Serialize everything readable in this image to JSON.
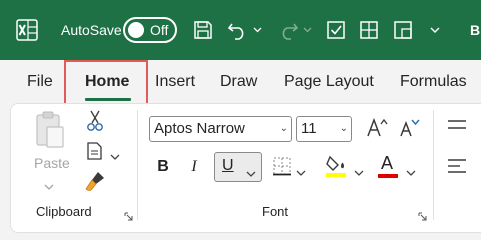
{
  "titlebar": {
    "autosave_label": "AutoSave",
    "autosave_state": "Off",
    "truncated_text": "B"
  },
  "tabs": [
    {
      "label": "File",
      "active": false
    },
    {
      "label": "Home",
      "active": true
    },
    {
      "label": "Insert",
      "active": false
    },
    {
      "label": "Draw",
      "active": false
    },
    {
      "label": "Page Layout",
      "active": false
    },
    {
      "label": "Formulas",
      "active": false
    }
  ],
  "ribbon": {
    "clipboard": {
      "paste_label": "Paste",
      "group_label": "Clipboard"
    },
    "font": {
      "font_name": "Aptos Narrow",
      "font_size": "11",
      "bold_label": "B",
      "italic_label": "I",
      "underline_label": "U",
      "font_color_label": "A",
      "group_label": "Font"
    }
  },
  "colors": {
    "accent": "#1e7145",
    "highlight_box": "#e25b5b",
    "font_color_bar": "#e00000",
    "fill_color_bar": "#ffff00"
  }
}
